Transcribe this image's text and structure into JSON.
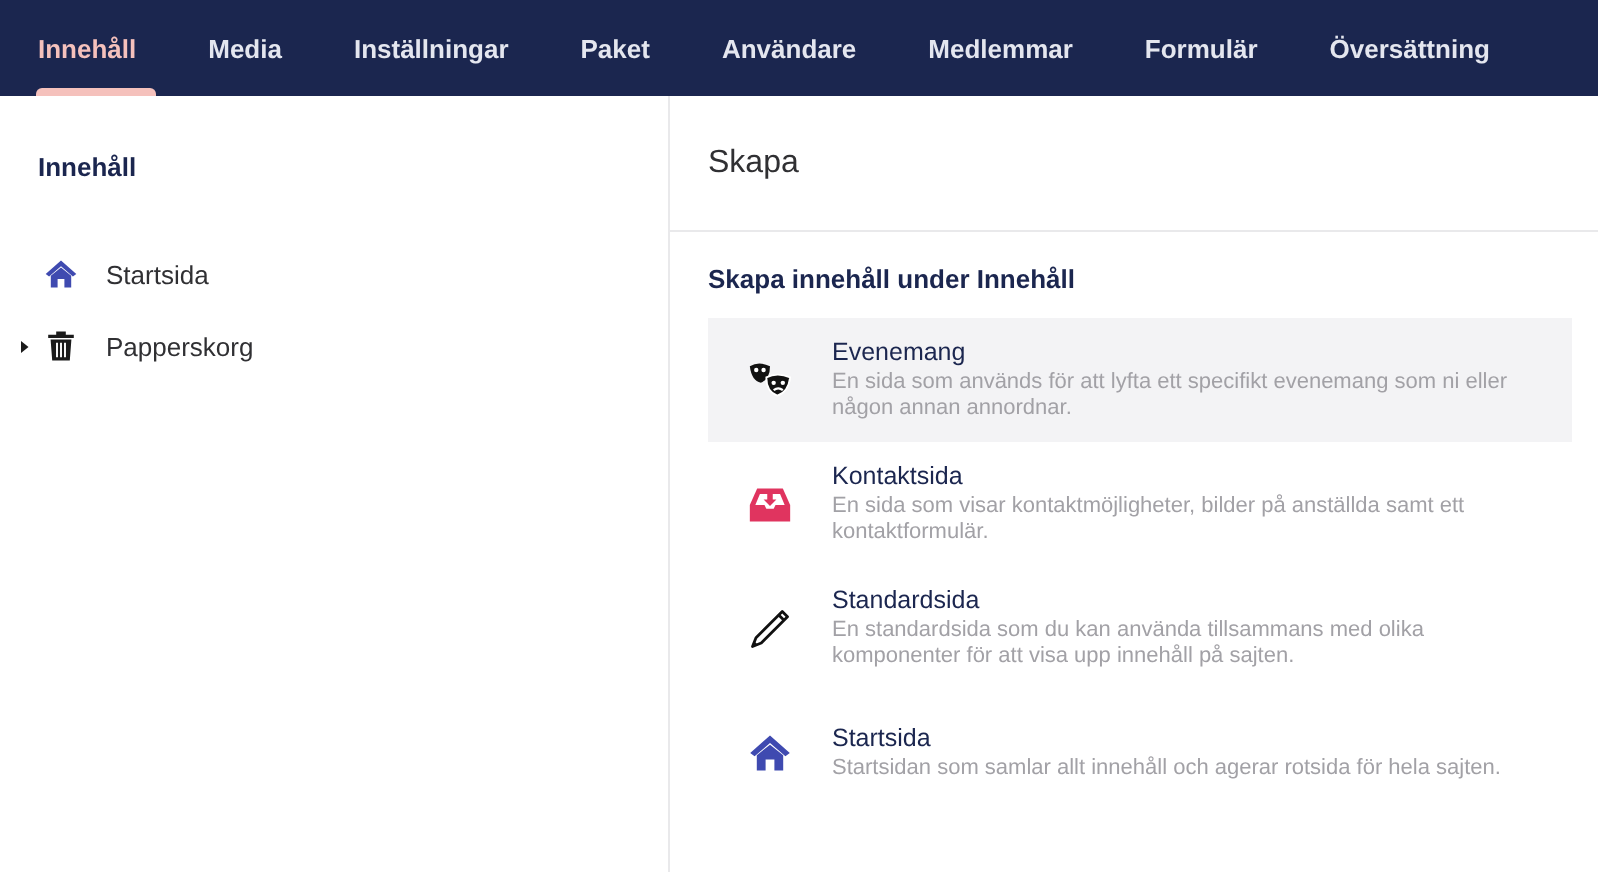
{
  "nav": [
    {
      "label": "Innehåll",
      "selected": true
    },
    {
      "label": "Media",
      "selected": false
    },
    {
      "label": "Inställningar",
      "selected": false
    },
    {
      "label": "Paket",
      "selected": false
    },
    {
      "label": "Användare",
      "selected": false
    },
    {
      "label": "Medlemmar",
      "selected": false
    },
    {
      "label": "Formulär",
      "selected": false
    },
    {
      "label": "Översättning",
      "selected": false
    }
  ],
  "sidebar": {
    "title": "Innehåll",
    "items": [
      {
        "label": "Startsida",
        "kind": "home"
      },
      {
        "label": "Papperskorg",
        "kind": "trash",
        "expanded": false
      }
    ]
  },
  "panel": {
    "title": "Skapa",
    "subtitle": "Skapa innehåll under Innehåll",
    "items": [
      {
        "name": "Evenemang",
        "description": "En sida som används för att lyfta ett specifikt evenemang som ni eller någon annan annordnar.",
        "kind": "masks",
        "selected": true
      },
      {
        "name": "Kontaktsida",
        "description": "En sida som visar kontaktmöjligheter, bilder på anställda samt ett kontaktformulär.",
        "kind": "inbox",
        "selected": false
      },
      {
        "name": "Standardsida",
        "description": "En standardsida som du kan använda tillsammans med olika komponenter för att visa upp innehåll på sajten.",
        "kind": "pencil",
        "selected": false
      },
      {
        "name": "Startsida",
        "description": "Startsidan som samlar allt innehåll och agerar rotsida för hela sajten.",
        "kind": "home",
        "selected": false
      }
    ]
  }
}
